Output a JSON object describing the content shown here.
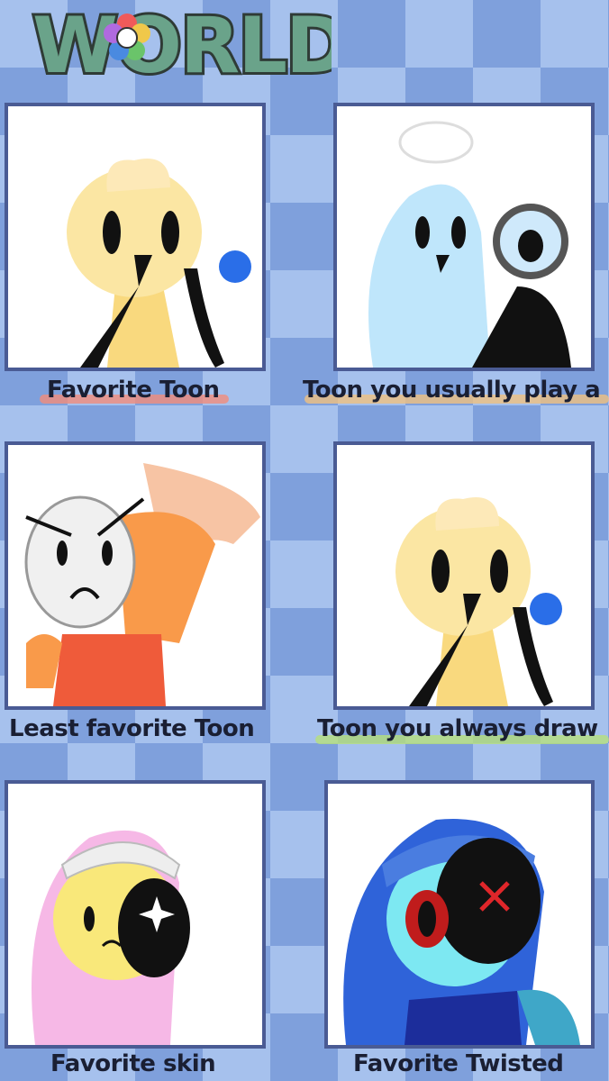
{
  "header": {
    "logo_text": "WORLD"
  },
  "panels": [
    {
      "caption": "Favorite Toon"
    },
    {
      "caption": "Toon you usually play a"
    },
    {
      "caption": "Least favorite Toon"
    },
    {
      "caption": "Toon you always draw"
    },
    {
      "caption": "Favorite skin"
    },
    {
      "caption": "Favorite Twisted"
    }
  ],
  "colors": {
    "panel_border": "#4a5b94",
    "bg_light": "#a9c3ee",
    "bg_dark": "#7e9fdc",
    "logo_fill": "#6aa38a"
  }
}
